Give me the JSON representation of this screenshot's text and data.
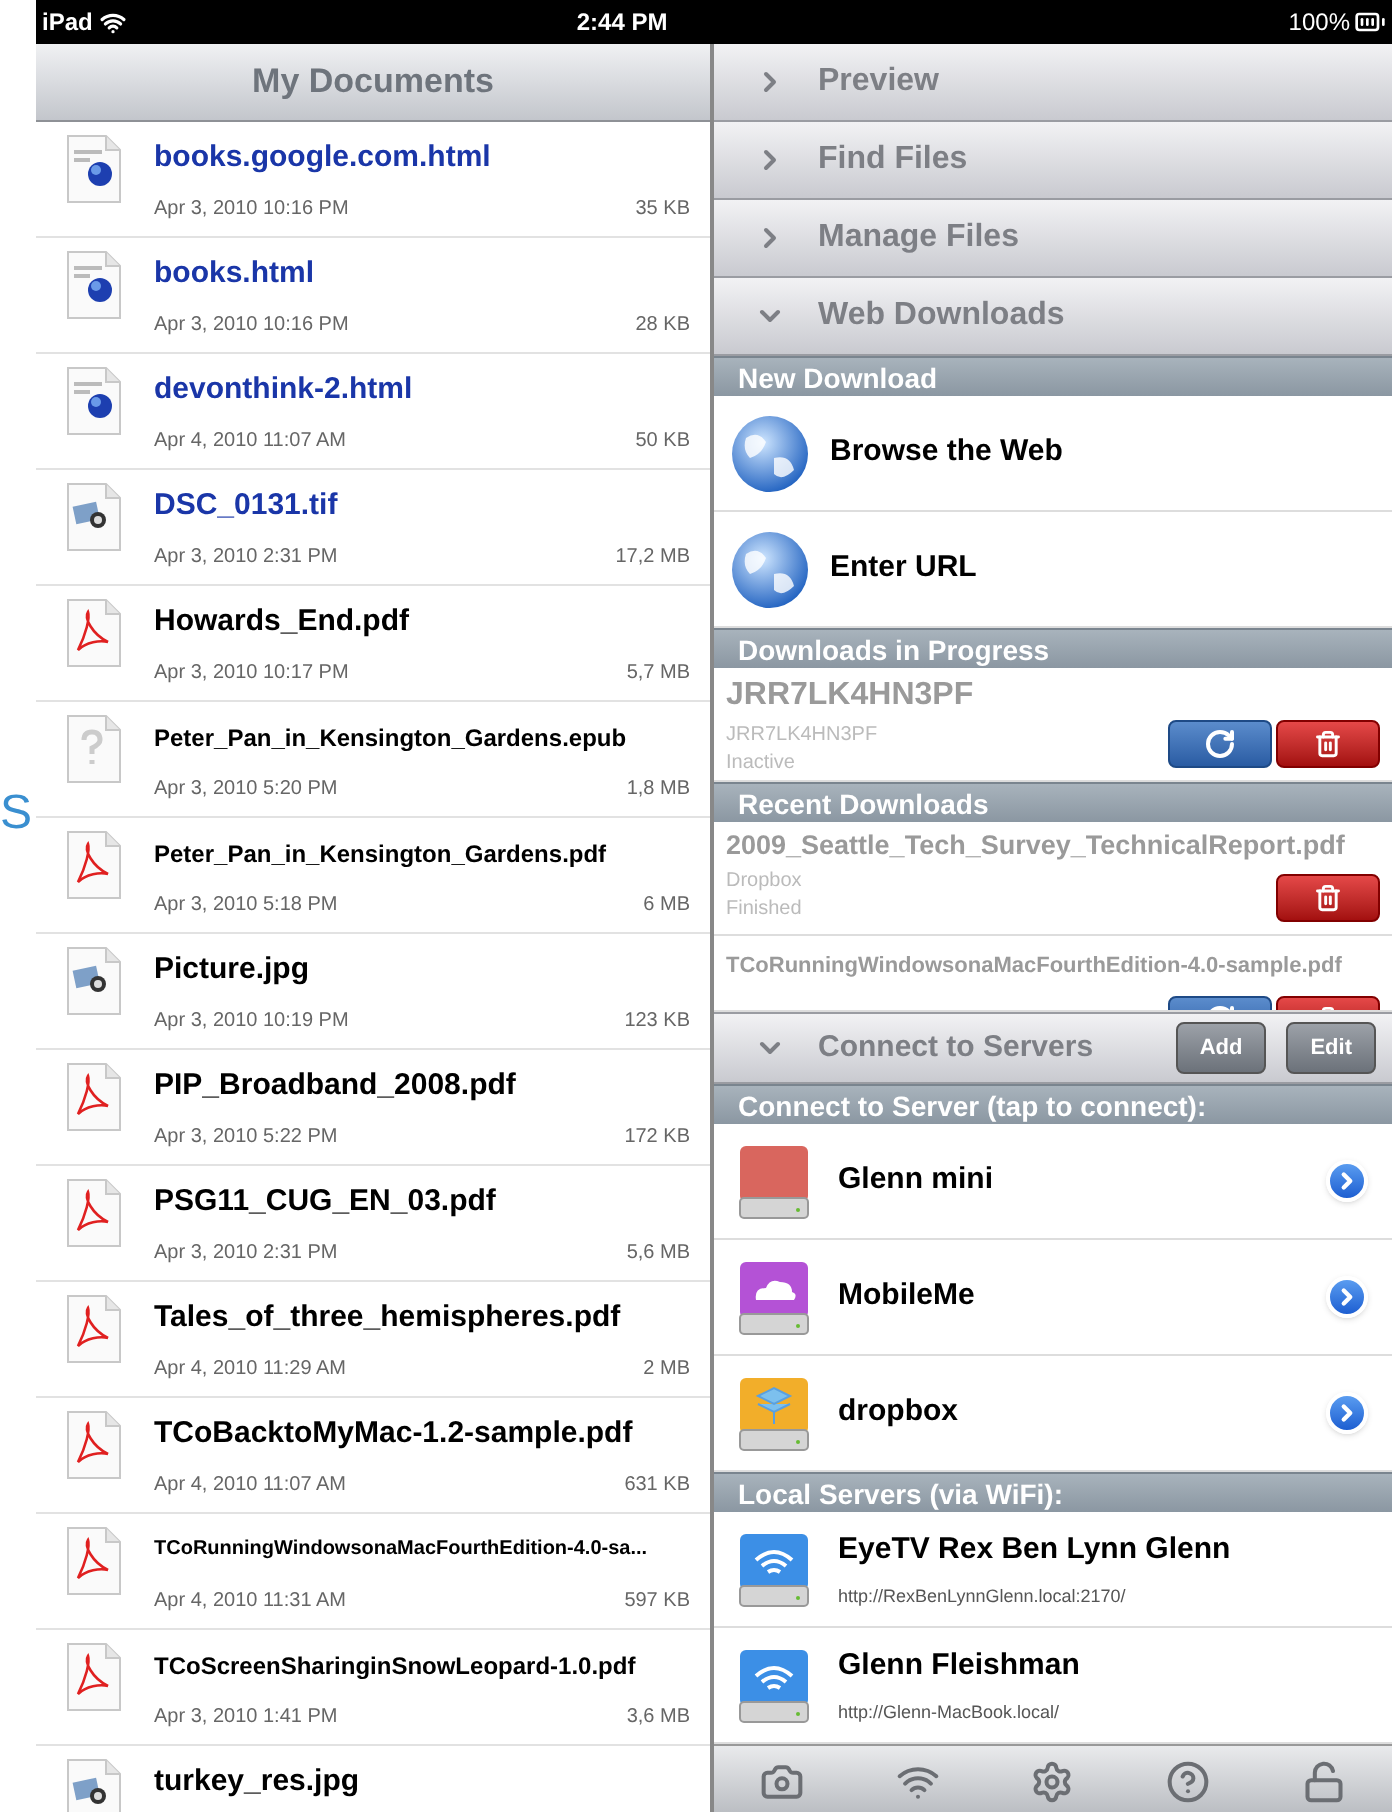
{
  "background_fragment": "S",
  "status_bar": {
    "device": "iPad",
    "time": "2:44 PM",
    "battery": "100%"
  },
  "documents": {
    "title": "My Documents",
    "files": [
      {
        "name": "books.google.com.html",
        "date": "Apr 3, 2010 10:16 PM",
        "size": "35 KB",
        "kind": "web",
        "highlighted": true
      },
      {
        "name": "books.html",
        "date": "Apr 3, 2010 10:16 PM",
        "size": "28 KB",
        "kind": "web",
        "highlighted": true
      },
      {
        "name": "devonthink-2.html",
        "date": "Apr 4, 2010 11:07 AM",
        "size": "50 KB",
        "kind": "web",
        "highlighted": true
      },
      {
        "name": "DSC_0131.tif",
        "date": "Apr 3, 2010 2:31 PM",
        "size": "17,2 MB",
        "kind": "image",
        "highlighted": true
      },
      {
        "name": "Howards_End.pdf",
        "date": "Apr 3, 2010 10:17 PM",
        "size": "5,7 MB",
        "kind": "pdf",
        "highlighted": false
      },
      {
        "name": "Peter_Pan_in_Kensington_Gardens.epub",
        "date": "Apr 3, 2010 5:20 PM",
        "size": "1,8 MB",
        "kind": "unknown",
        "highlighted": false
      },
      {
        "name": "Peter_Pan_in_Kensington_Gardens.pdf",
        "date": "Apr 3, 2010 5:18 PM",
        "size": "6 MB",
        "kind": "pdf",
        "highlighted": false
      },
      {
        "name": "Picture.jpg",
        "date": "Apr 3, 2010 10:19 PM",
        "size": "123 KB",
        "kind": "image",
        "highlighted": false
      },
      {
        "name": "PIP_Broadband_2008.pdf",
        "date": "Apr 3, 2010 5:22 PM",
        "size": "172 KB",
        "kind": "pdf",
        "highlighted": false
      },
      {
        "name": "PSG11_CUG_EN_03.pdf",
        "date": "Apr 3, 2010 2:31 PM",
        "size": "5,6 MB",
        "kind": "pdf",
        "highlighted": false
      },
      {
        "name": "Tales_of_three_hemispheres.pdf",
        "date": "Apr 4, 2010 11:29 AM",
        "size": "2 MB",
        "kind": "pdf",
        "highlighted": false
      },
      {
        "name": "TCoBacktoMyMac-1.2-sample.pdf",
        "date": "Apr 4, 2010 11:07 AM",
        "size": "631 KB",
        "kind": "pdf",
        "highlighted": false
      },
      {
        "name": "TCoRunningWindowsonaMacFourthEdition-4.0-sa...",
        "date": "Apr 4, 2010 11:31 AM",
        "size": "597 KB",
        "kind": "pdf",
        "highlighted": false
      },
      {
        "name": "TCoScreenSharinginSnowLeopard-1.0.pdf",
        "date": "Apr 3, 2010 1:41 PM",
        "size": "3,6 MB",
        "kind": "pdf",
        "highlighted": false
      },
      {
        "name": "turkey_res.jpg",
        "kind": "image",
        "highlighted": false
      }
    ]
  },
  "panels": [
    {
      "label": "Preview",
      "expanded": false
    },
    {
      "label": "Find Files",
      "expanded": false
    },
    {
      "label": "Manage Files",
      "expanded": false
    },
    {
      "label": "Web Downloads",
      "expanded": true
    }
  ],
  "new_download": {
    "header": "New Download",
    "items": [
      "Browse the Web",
      "Enter URL"
    ]
  },
  "in_progress": {
    "header": "Downloads in Progress",
    "items": [
      {
        "title": "JRR7LK4HN3PF",
        "source": "JRR7LK4HN3PF",
        "status": "Inactive",
        "actions": [
          {
            "kind": "retry"
          },
          {
            "kind": "delete"
          }
        ]
      }
    ]
  },
  "recent": {
    "header": "Recent Downloads",
    "items": [
      {
        "title": "2009_Seattle_Tech_Survey_TechnicalReport.pdf",
        "source": "Dropbox",
        "status": "Finished",
        "actions": [
          {
            "kind": "delete"
          }
        ]
      },
      {
        "title": "TCoRunningWindowsonaMacFourthEdition-4.0-sample.pdf",
        "actions": [
          {
            "kind": "retry"
          },
          {
            "kind": "delete"
          }
        ]
      }
    ]
  },
  "servers_panel": {
    "label": "Connect to Servers",
    "expanded": true,
    "buttons": [
      "Add",
      "Edit"
    ]
  },
  "connect": {
    "header": "Connect to Server (tap to connect):",
    "servers": [
      {
        "name": "Glenn mini",
        "kind": "drive"
      },
      {
        "name": "MobileMe",
        "kind": "cloud"
      },
      {
        "name": "dropbox",
        "kind": "box"
      }
    ]
  },
  "local": {
    "header": "Local Servers (via WiFi):",
    "servers": [
      {
        "name": "EyeTV Rex Ben Lynn Glenn",
        "url": "http://RexBenLynnGlenn.local:2170/"
      },
      {
        "name": "Glenn Fleishman",
        "url": "http://Glenn-MacBook.local/"
      }
    ]
  },
  "toolbar": [
    {
      "kind": "camera"
    },
    {
      "kind": "wifi"
    },
    {
      "kind": "settings"
    },
    {
      "kind": "help"
    },
    {
      "kind": "unlock"
    }
  ]
}
